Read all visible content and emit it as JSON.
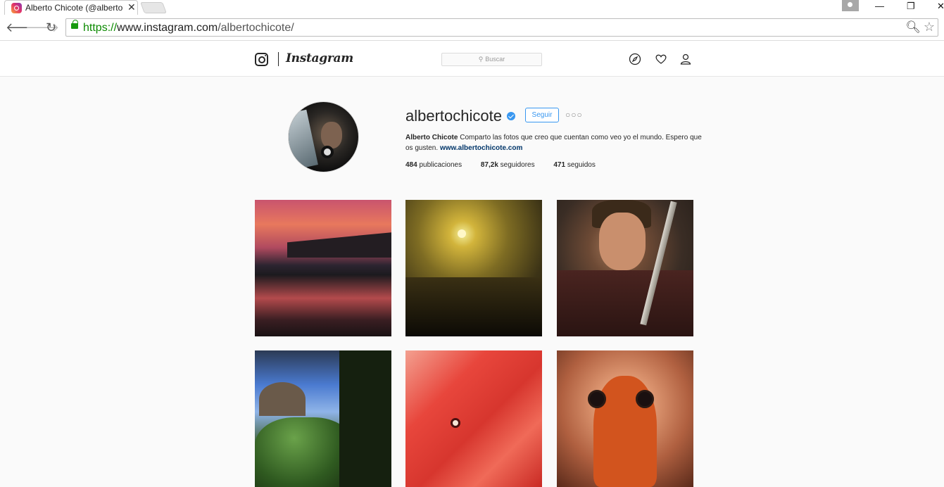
{
  "browser": {
    "tab_title": "Alberto Chicote (@alberto",
    "tab_close": "✕",
    "url_scheme": "https://",
    "url_host": "www.instagram.com",
    "url_path": "/albertochicote/"
  },
  "header": {
    "wordmark": "Instagram",
    "search_placeholder": "Buscar"
  },
  "profile": {
    "username": "albertochicote",
    "follow_label": "Seguir",
    "more_label": "○○○",
    "full_name": "Alberto Chicote",
    "bio_text": "Comparto las fotos que creo que cuentan como veo yo el mundo. Espero que os gusten.",
    "website": "www.albertochicote.com",
    "posts_count": "484",
    "posts_label": "publicaciones",
    "followers_count": "87,2k",
    "followers_label": "seguidores",
    "following_count": "471",
    "following_label": "seguidos"
  },
  "colors": {
    "accent": "#3897f0",
    "link": "#003569",
    "ssl_green": "#0b8a00"
  }
}
